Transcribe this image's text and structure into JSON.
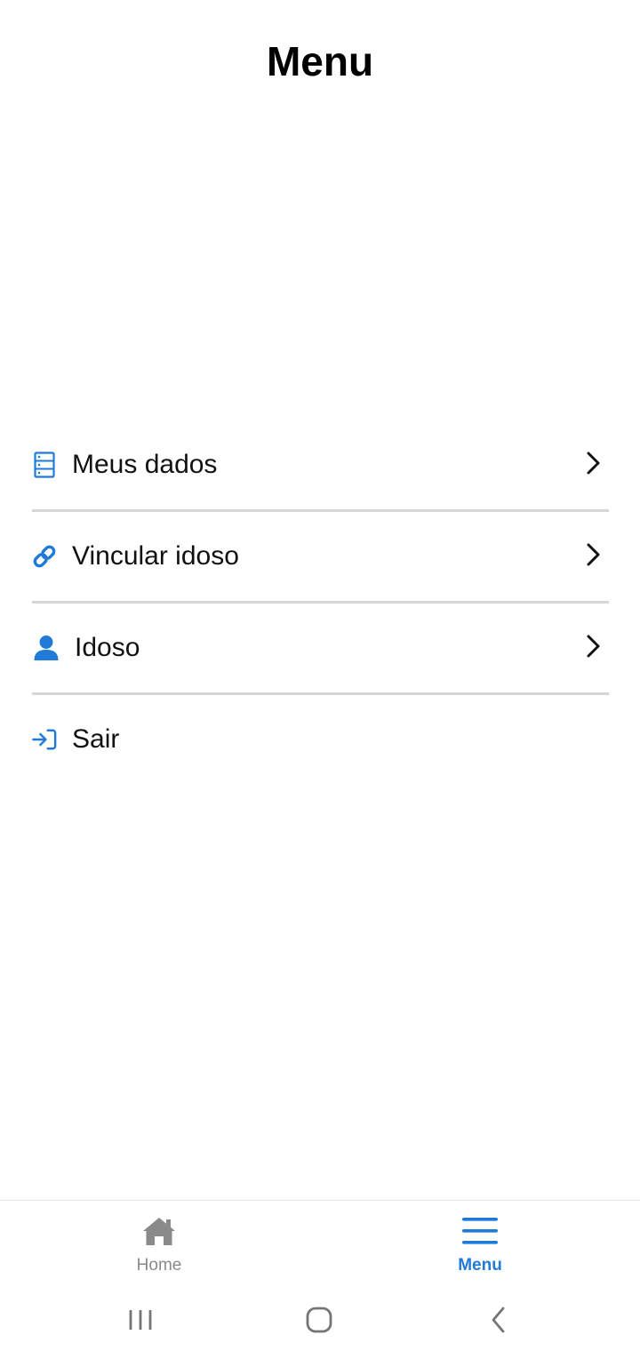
{
  "header": {
    "title": "Menu"
  },
  "menu": {
    "items": [
      {
        "label": "Meus dados",
        "icon": "data-list-icon"
      },
      {
        "label": "Vincular idoso",
        "icon": "link-icon"
      },
      {
        "label": "Idoso",
        "icon": "user-icon"
      },
      {
        "label": "Sair",
        "icon": "logout-icon"
      }
    ]
  },
  "bottom_nav": {
    "tabs": [
      {
        "label": "Home",
        "icon": "home-icon",
        "active": false
      },
      {
        "label": "Menu",
        "icon": "hamburger-menu-icon",
        "active": true
      }
    ]
  },
  "system_nav": {
    "buttons": [
      "recent-apps-icon",
      "home-circle-icon",
      "back-icon"
    ]
  },
  "colors": {
    "accent": "#1f7ad8",
    "inactive": "#8a8a8a",
    "divider": "#d6d6d6",
    "text": "#111111"
  }
}
